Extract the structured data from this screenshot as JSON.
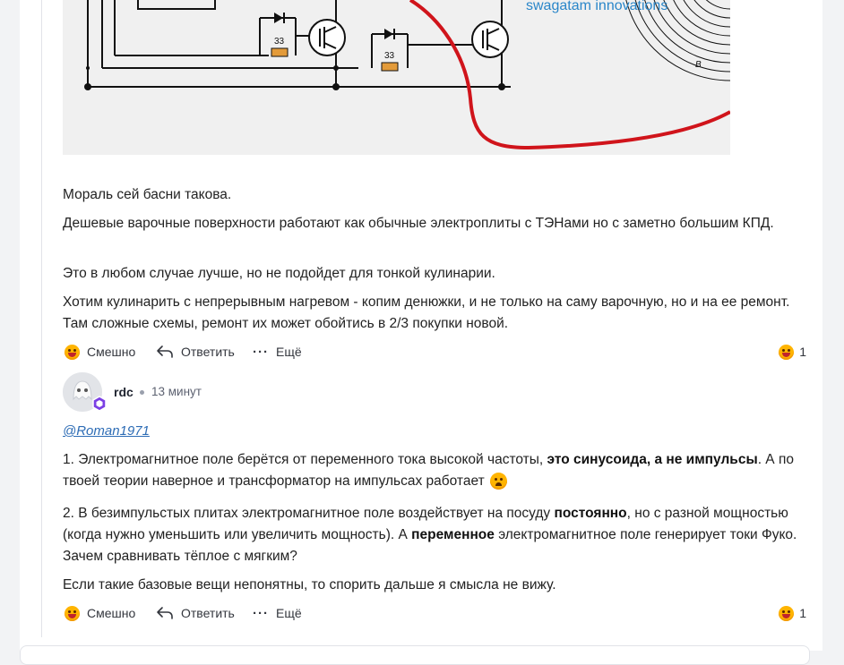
{
  "post": {
    "image_watermark": "swagatam innovations",
    "image_label_1": "33",
    "image_label_2": "33",
    "image_label_b": "B",
    "paragraphs": [
      "Мораль сей басни такова.",
      "Дешевые варочные поверхности работают как обычные электроплиты с ТЭНами но с заметно большим КПД.",
      "Это в любом случае лучше, но не подойдет для тонкой кулинарии.",
      "Хотим кулинарить с непрерывным нагревом - копим денюжки, и не только на саму варочную, но и на ее ремонт. Там сложные схемы, ремонт их может обойтись в 2/3 покупки новой."
    ],
    "actions": {
      "funny": "Смешно",
      "reply": "Ответить",
      "more": "Ещё",
      "reaction_count": "1"
    }
  },
  "reply_comment": {
    "author": "rdc",
    "time": "13 минут",
    "mention": "@Roman1971",
    "p1_a": "1. Электромагнитное поле берётся от переменного тока высокой частоты, ",
    "p1_b": "это синусоида, а не импульсы",
    "p1_c": ". А по твоей теории наверное и трансформатор на импульсах работает",
    "p2_a": "2. В безимпульстых плитах электромагнитное поле воздействует на посуду ",
    "p2_b": "постоянно",
    "p2_c": ", но с разной мощностью (когда нужно уменьшить или увеличить мощность). А ",
    "p2_d": "переменное",
    "p2_e": " электромагнитное поле генерирует токи Фуко. Зачем сравнивать тёплое с мягким?",
    "p3": "Если такие базовые вещи непонятны, то спорить дальше я смысла не вижу.",
    "actions": {
      "funny": "Смешно",
      "reply": "Ответить",
      "more": "Ещё",
      "reaction_count": "1"
    }
  },
  "icons": {
    "reaction": "laughing-emoji-icon",
    "reply": "reply-arrow-icon",
    "more": "more-dots-icon",
    "badge": "hexagon-badge-icon",
    "inline_emoji": "smirk-emoji-icon"
  },
  "colors": {
    "link": "#2d6cb5",
    "emoji": "#ffb400",
    "wire_red": "#d0141b",
    "watermark": "#2a86c9"
  }
}
